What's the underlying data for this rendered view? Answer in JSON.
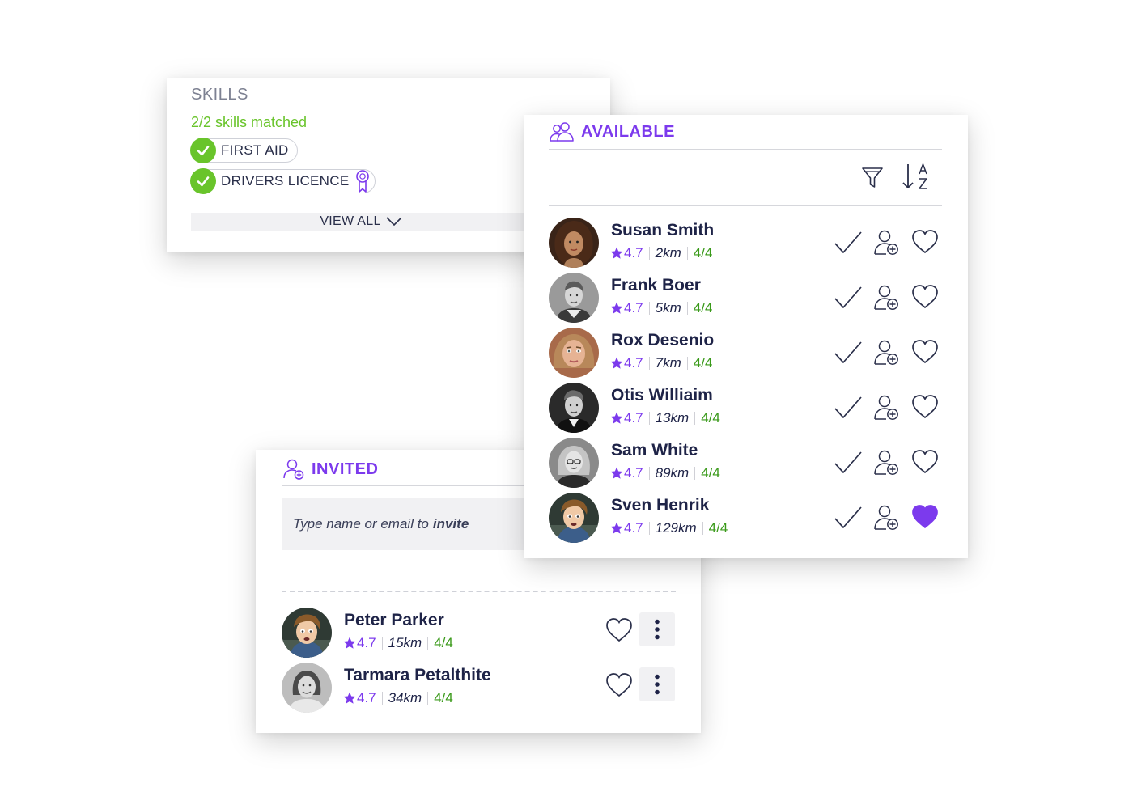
{
  "skills": {
    "title": "SKILLS",
    "matched": "2/2 skills matched",
    "items": [
      {
        "label": "FIRST AID",
        "certified": false
      },
      {
        "label": "DRIVERS LICENCE",
        "certified": true
      }
    ],
    "view_all": "VIEW ALL"
  },
  "available": {
    "title": "AVAILABLE",
    "people": [
      {
        "name": "Susan Smith",
        "rating": "4.7",
        "distance": "2km",
        "score": "4/4",
        "favorite": false
      },
      {
        "name": "Frank Boer",
        "rating": "4.7",
        "distance": "5km",
        "score": "4/4",
        "favorite": false
      },
      {
        "name": "Rox Desenio",
        "rating": "4.7",
        "distance": "7km",
        "score": "4/4",
        "favorite": false
      },
      {
        "name": "Otis Williaim",
        "rating": "4.7",
        "distance": "13km",
        "score": "4/4",
        "favorite": false
      },
      {
        "name": "Sam White",
        "rating": "4.7",
        "distance": "89km",
        "score": "4/4",
        "favorite": false
      },
      {
        "name": "Sven Henrik",
        "rating": "4.7",
        "distance": "129km",
        "score": "4/4",
        "favorite": true
      }
    ]
  },
  "invited": {
    "title": "INVITED",
    "placeholder_prefix": "Type name or email to",
    "placeholder_emphasis": "invite",
    "people": [
      {
        "name": "Peter Parker",
        "rating": "4.7",
        "distance": "15km",
        "score": "4/4",
        "favorite": false
      },
      {
        "name": "Tarmara Petalthite",
        "rating": "4.7",
        "distance": "34km",
        "score": "4/4",
        "favorite": false
      }
    ]
  },
  "colors": {
    "accent": "#7c3aed",
    "success": "#69c42b",
    "score": "#3a9a1a",
    "text": "#1e2347"
  }
}
